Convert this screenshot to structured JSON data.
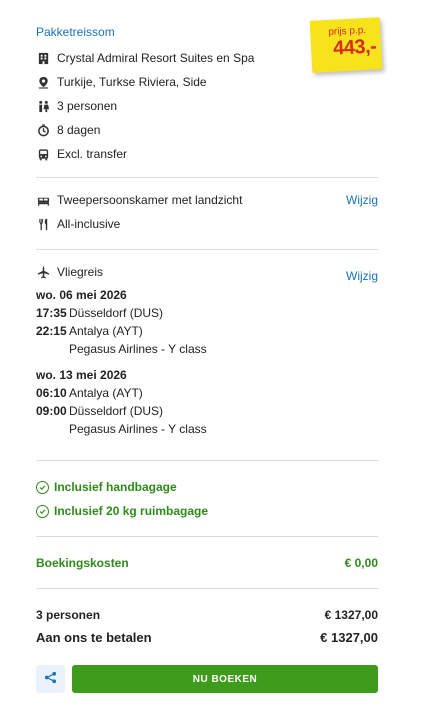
{
  "summary": {
    "title": "Pakketreissom",
    "price_label": "prijs p.p.",
    "price": "443,-",
    "hotel": "Crystal Admiral Resort Suites en Spa",
    "location": "Turkije, Turkse Riviera, Side",
    "persons": "3 personen",
    "duration": "8 dagen",
    "transfer": "Excl. transfer"
  },
  "room": {
    "type": "Tweepersoonskamer met landzicht",
    "board": "All-inclusive",
    "change_label": "Wijzig"
  },
  "flight": {
    "label": "Vliegreis",
    "change_label": "Wijzig",
    "outbound": {
      "date": "wo. 06 mei 2026",
      "dep_time": "17:35",
      "dep_airport": "Düsseldorf (DUS)",
      "arr_time": "22:15",
      "arr_airport": "Antalya (AYT)",
      "airline": "Pegasus Airlines - Y class"
    },
    "return": {
      "date": "wo. 13 mei 2026",
      "dep_time": "06:10",
      "dep_airport": "Antalya (AYT)",
      "arr_time": "09:00",
      "arr_airport": "Düsseldorf (DUS)",
      "airline": "Pegasus Airlines - Y class"
    }
  },
  "baggage": {
    "hand": "Inclusief handbagage",
    "hold": "Inclusief 20 kg ruimbagage"
  },
  "costs": {
    "booking_label": "Boekingskosten",
    "booking_value": "€ 0,00",
    "persons_label": "3 personen",
    "persons_value": "€ 1327,00",
    "total_label": "Aan ons te betalen",
    "total_value": "€ 1327,00"
  },
  "actions": {
    "book_label": "NU BOEKEN"
  },
  "colors": {
    "link": "#1a73b8",
    "green": "#2e8b1a",
    "button": "#3e9b1c",
    "price_tag": "#f8e21c",
    "price_text": "#d62b1f"
  }
}
